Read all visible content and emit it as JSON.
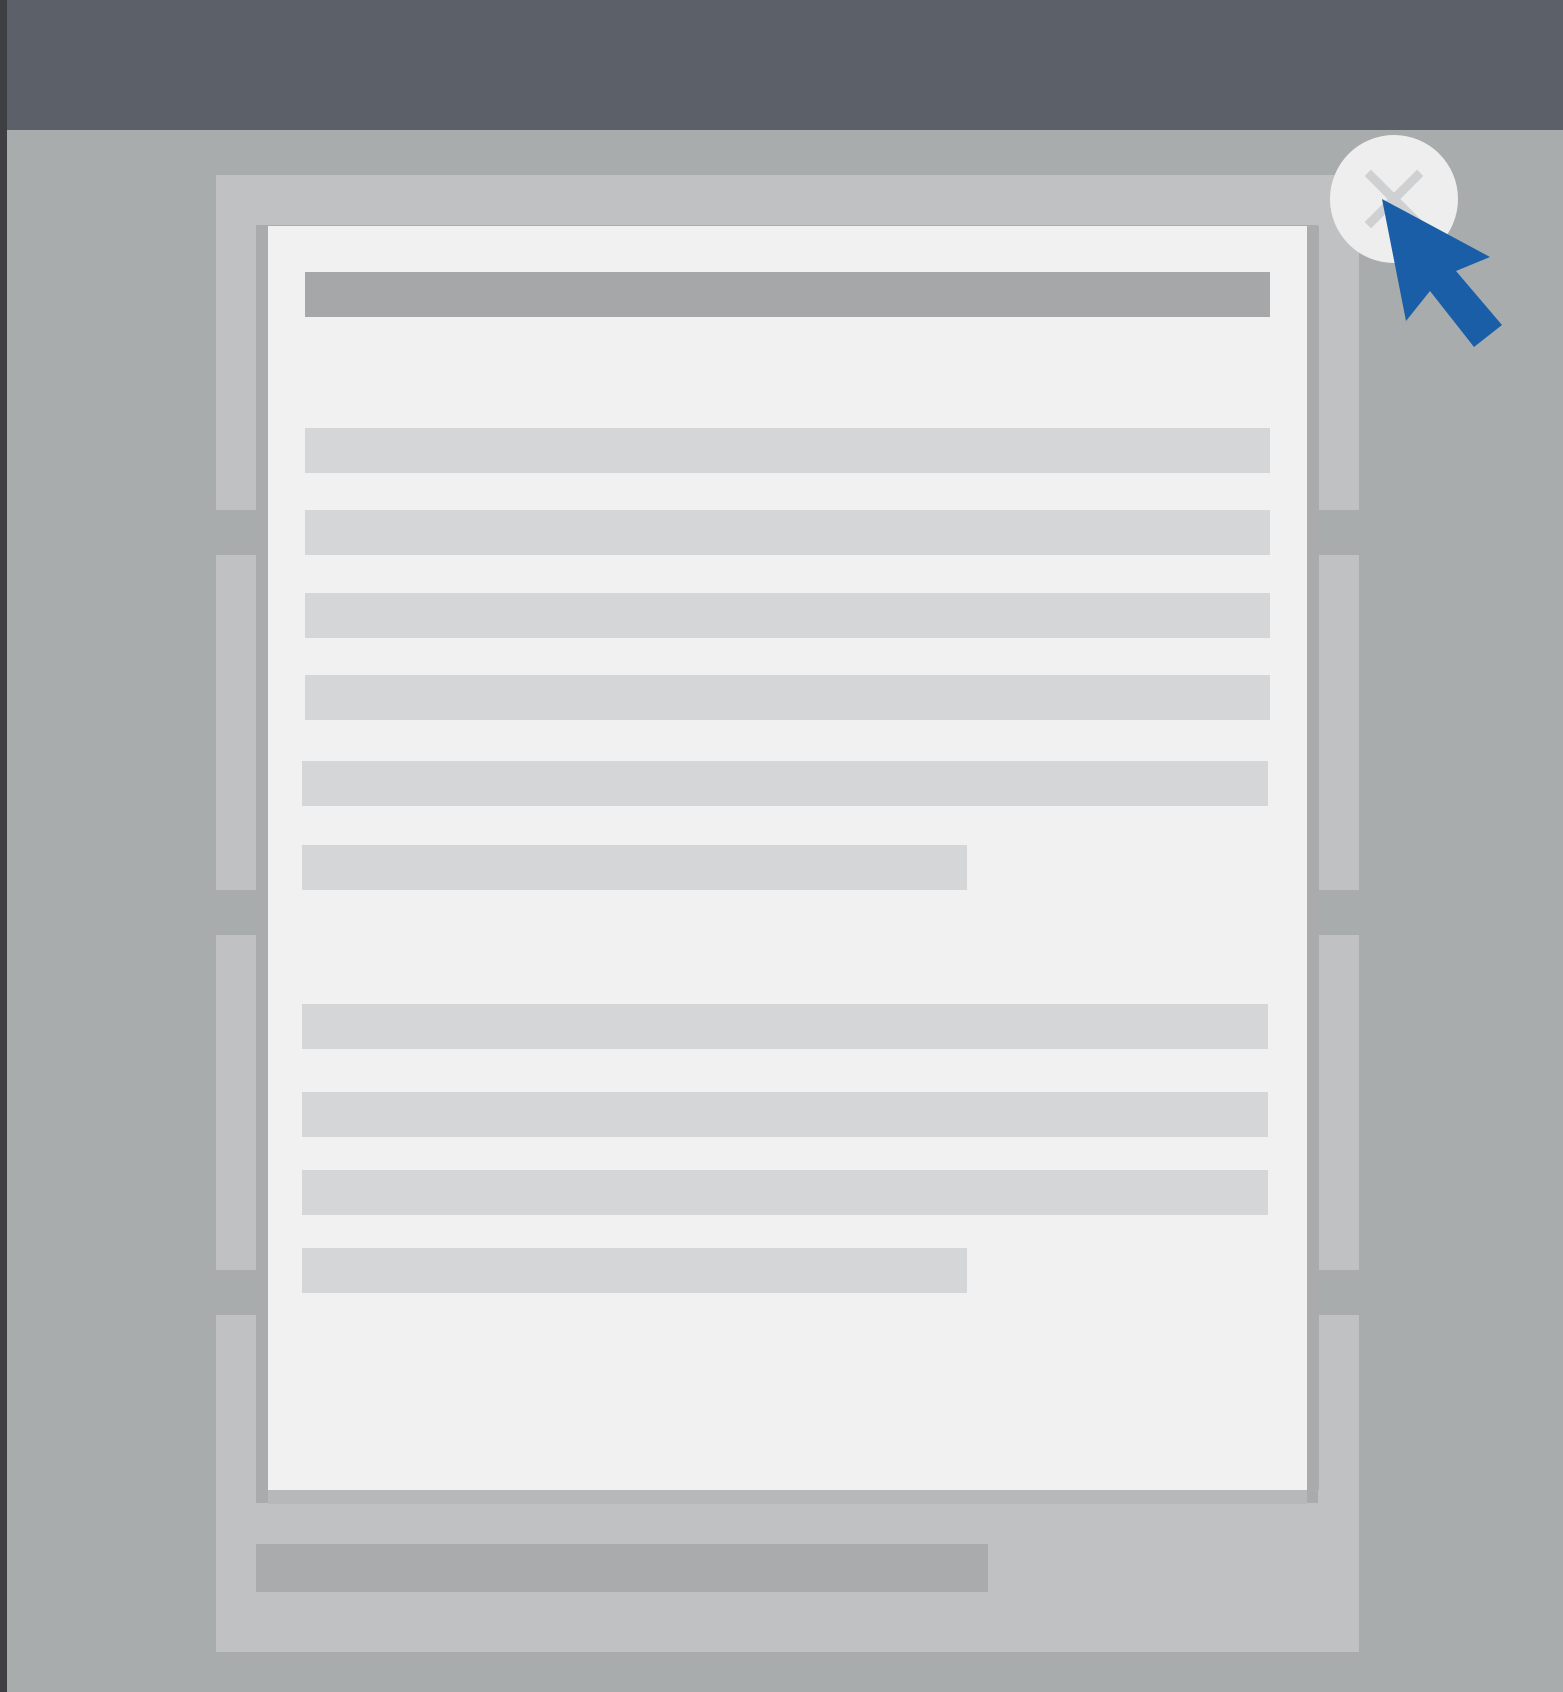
{
  "app": {
    "window_chrome": "dark top bar",
    "theme_colors": {
      "top_bar": "#5c6068",
      "background": "#a9acad",
      "modal": "#f1f1f1",
      "placeholder_line": "#d5d6d8",
      "title_placeholder": "#a5a7a8",
      "cursor": "#1a5ea8"
    }
  },
  "background_page": {
    "cards": [
      {
        "line_count": 4
      },
      {
        "line_count": 4
      },
      {
        "line_count": 4
      },
      {
        "line_count": 4
      }
    ]
  },
  "modal": {
    "title_placeholder": "",
    "paragraphs": [
      {
        "line_count": 6
      },
      {
        "line_count": 4
      }
    ],
    "close_control": {
      "icon": "close-icon",
      "state": "hovered"
    }
  },
  "pointer": {
    "icon": "cursor-arrow-icon",
    "color": "#1a5ea8"
  }
}
